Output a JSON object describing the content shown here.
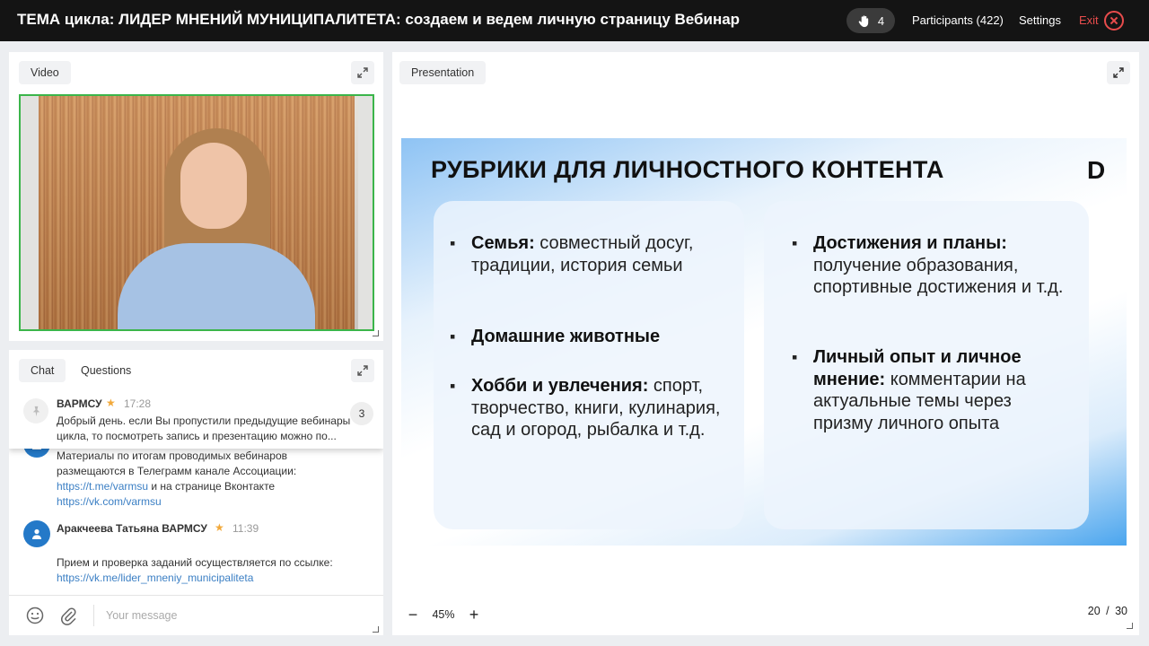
{
  "header": {
    "title": "ТЕМА цикла: ЛИДЕР МНЕНИЙ МУНИЦИПАЛИТЕТА: создаем и ведем личную страницу Вебинар",
    "raised_hands": "4",
    "participants": "Participants (422)",
    "settings": "Settings",
    "exit": "Exit"
  },
  "video": {
    "tab": "Video"
  },
  "chat": {
    "tabs": [
      "Chat",
      "Questions"
    ],
    "pinned": {
      "author": "ВАРМСУ",
      "time": "17:28",
      "text_line1": "Добрый день. если Вы пропустили предыдущие вебинары",
      "text_line2": "цикла, то посмотреть запись и презентацию можно по...",
      "count": "3"
    },
    "messages": [
      {
        "line1": "Материалы по итогам проводимых вебинаров",
        "line2": "размещаются в Телеграмм канале Ассоциации:",
        "link1": "https://t.me/varmsu",
        "mid": " и на странице Вконтакте",
        "link2": "https://vk.com/varmsu"
      },
      {
        "author": "Аракчеева Татьяна ВАРМСУ",
        "time": "11:39",
        "line1": "Прием и проверка заданий осуществляется по ссылке:",
        "link": "https://vk.me/lider_mneniy_municipaliteta"
      }
    ],
    "input_placeholder": "Your message"
  },
  "presentation": {
    "tab": "Presentation",
    "zoom": "45%",
    "zoom_minus": "−",
    "zoom_plus": "+",
    "page": "20 / 30",
    "slide": {
      "title": "РУБРИКИ ДЛЯ ЛИЧНОСТНОГО КОНТЕНТА",
      "logo": "D",
      "left": [
        {
          "bold": "Семья:",
          "text": " совместный досуг, традиции, история семьи"
        },
        {
          "bold": "Домашние животные",
          "text": ""
        },
        {
          "bold": "Хобби и увлечения:",
          "text": " спорт, творчество, книги, кулинария, сад и огород, рыбалка и т.д."
        }
      ],
      "right": [
        {
          "bold": "Достижения и планы:",
          "text": " получение образования, спортивные достижения и т.д."
        },
        {
          "bold": "Личный опыт и личное мнение:",
          "text": " комментарии на актуальные темы через призму личного опыта"
        }
      ]
    }
  }
}
